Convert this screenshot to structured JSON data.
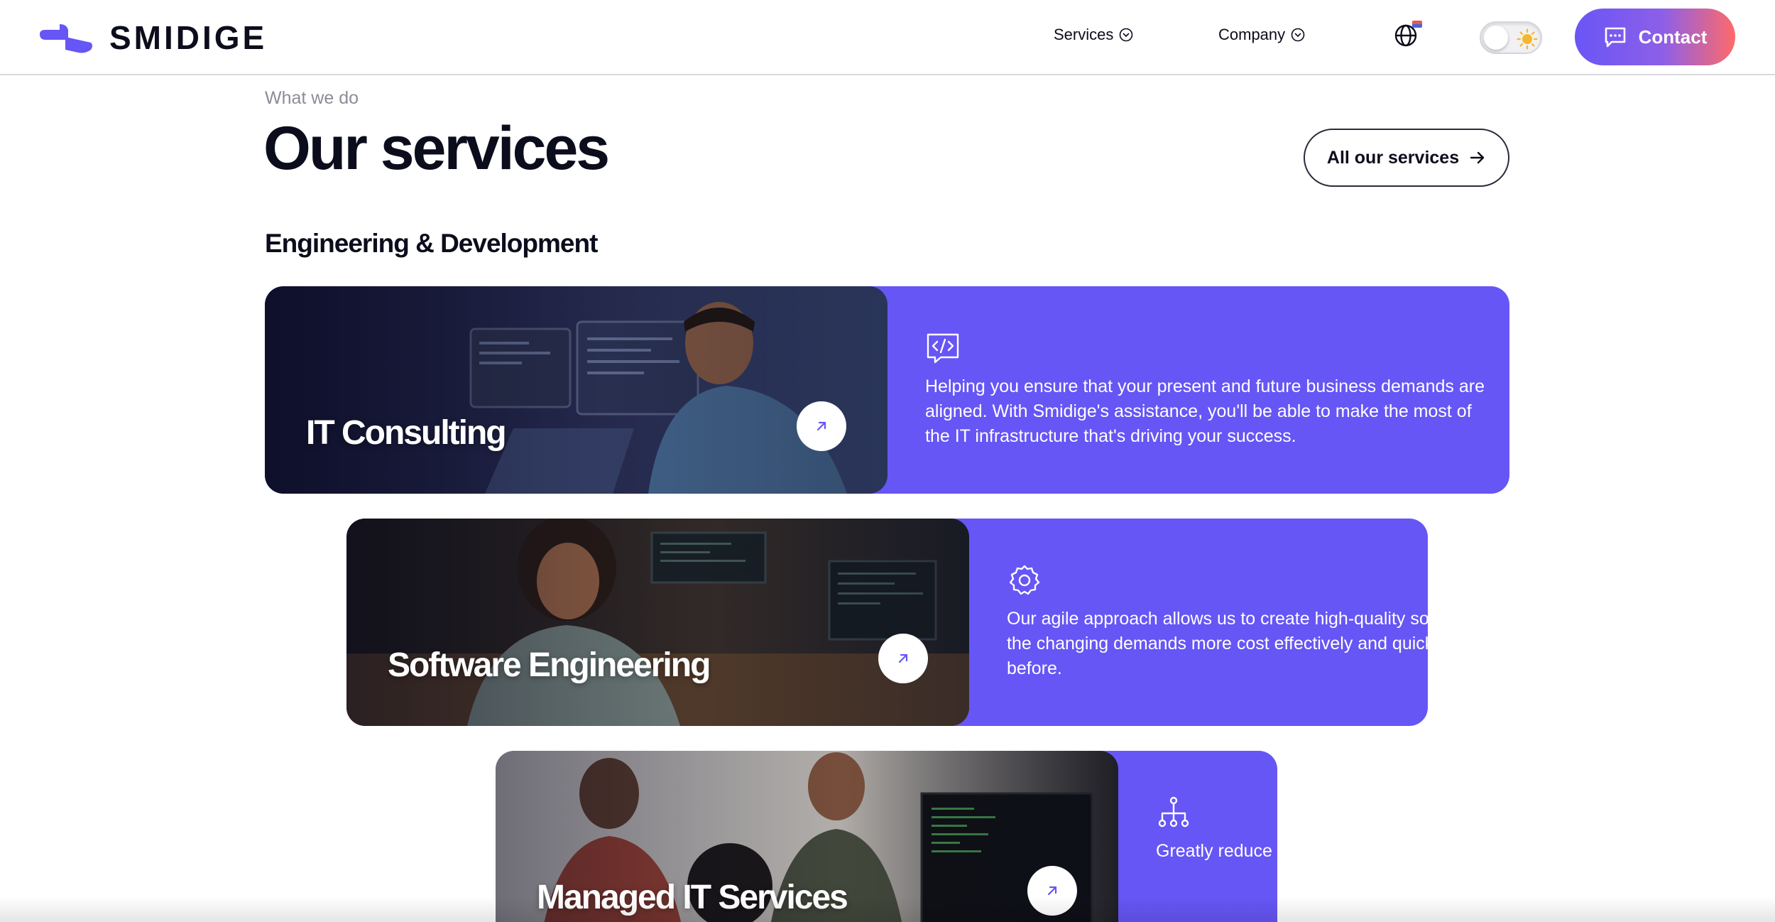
{
  "brand": {
    "name": "SMIDIGE"
  },
  "nav": {
    "items": [
      {
        "label": "Services"
      },
      {
        "label": "Company"
      }
    ],
    "contact_label": "Contact"
  },
  "colors": {
    "accent": "#6656f5",
    "contact_gradient_start": "#6a55f6",
    "contact_gradient_end": "#ff6a6a",
    "text": "#0c0d1c"
  },
  "section": {
    "eyebrow": "What we do",
    "title": "Our services",
    "all_label": "All our services",
    "subheading": "Engineering & Development"
  },
  "cards": [
    {
      "title": "IT Consulting",
      "icon": "code-icon",
      "description": "Helping you ensure that your present and future business demands are aligned. With Smidige's assistance, you'll be able to make the most of the IT infrastructure that's driving your success."
    },
    {
      "title": "Software Engineering",
      "icon": "gear-icon",
      "description": "Our agile approach allows us to create high-quality solutions that meet the changing demands more cost effectively and quickly than ever before."
    },
    {
      "title": "Managed IT Services",
      "icon": "network-icon",
      "description": "Greatly reduce system functio services while"
    }
  ]
}
